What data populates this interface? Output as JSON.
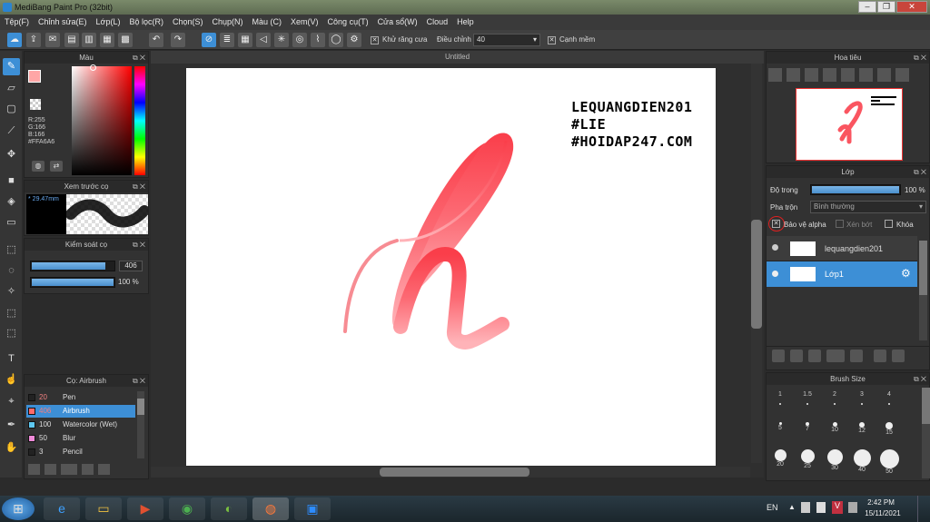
{
  "window": {
    "title": "MediBang Paint Pro (32bit)"
  },
  "menu": [
    "Tệp(F)",
    "Chỉnh sửa(E)",
    "Lớp(L)",
    "Bộ lọc(R)",
    "Chọn(S)",
    "Chụp(N)",
    "Màu (C)",
    "Xem(V)",
    "Công cụ(T)",
    "Cửa sổ(W)",
    "Cloud",
    "Help"
  ],
  "toolbar": {
    "antialias_label": "Khử răng cưa",
    "adjust_label": "Điều chỉnh",
    "adjust_value": "40",
    "edge_label": "Cạnh mềm"
  },
  "color_panel": {
    "title": "Màu",
    "r": "R:255",
    "g": "G:166",
    "b": "B:166",
    "hex": "#FFA6A6",
    "primary": "#ffa6a6"
  },
  "brush_preview": {
    "title": "Xem trước cọ",
    "size": "29.47mm"
  },
  "brush_control": {
    "title": "Kiểm soát cọ",
    "size_value": "406",
    "opacity_value": "100 %",
    "size_fill": 0.9,
    "opacity_fill": 1.0
  },
  "brush_list": {
    "title": "Cọ: Airbrush",
    "items": [
      {
        "size": "20",
        "name": "Pen",
        "color": "#222222"
      },
      {
        "size": "406",
        "name": "Airbrush",
        "color": "#ff6a6a"
      },
      {
        "size": "100",
        "name": "Watercolor (Wet)",
        "color": "#5ec8f0"
      },
      {
        "size": "50",
        "name": "Blur",
        "color": "#f08ad8"
      },
      {
        "size": "3",
        "name": "Pencil",
        "color": "#222222"
      }
    ]
  },
  "canvas": {
    "tab": "Untitled",
    "text_lines": [
      "LEQUANGDIEN201",
      "#LIE",
      "#HOIDAP247.COM"
    ]
  },
  "navigator": {
    "title": "Hoa tiêu"
  },
  "layers": {
    "title": "Lớp",
    "opacity_label": "Độ trong",
    "opacity_value": "100 %",
    "opacity_fill": 1.0,
    "blend_label": "Pha trộn",
    "blend_value": "Bình thường",
    "protect_alpha": "Bảo vệ alpha",
    "clipping": "Xén bớt",
    "lock": "Khóa",
    "items": [
      {
        "name": "lequangdien201"
      },
      {
        "name": "Lớp1"
      }
    ]
  },
  "brush_size": {
    "title": "Brush Size",
    "sizes": [
      "1",
      "1.5",
      "2",
      "3",
      "4",
      "5",
      "7",
      "10",
      "12",
      "15",
      "20",
      "25",
      "30",
      "40",
      "50"
    ]
  },
  "taskbar": {
    "lang": "EN",
    "time": "2:42 PM",
    "date": "15/11/2021"
  }
}
